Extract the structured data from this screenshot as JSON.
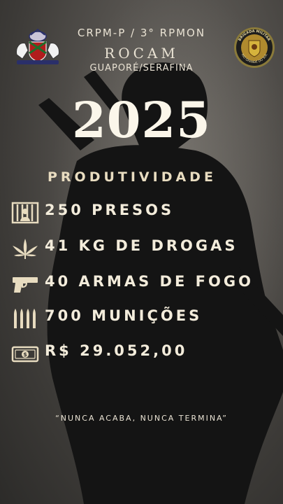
{
  "header": {
    "line1": "CRPM-P / 3° RPMON",
    "line2": "ROCAM",
    "line3": "GUAPORÉ/SERAFINA"
  },
  "right_badge": {
    "top_text": "BRIGADA MILITAR",
    "bottom_text": "RIO GRANDE DO SUL"
  },
  "year": "2025",
  "subtitle": "PRODUTIVIDADE",
  "stats": [
    {
      "icon": "jail-bars-icon",
      "label": "250 PRESOS"
    },
    {
      "icon": "cannabis-leaf-icon",
      "label": "41 KG DE DROGAS"
    },
    {
      "icon": "pistol-icon",
      "label": "40 ARMAS DE FOGO"
    },
    {
      "icon": "ammunition-icon",
      "label": "700 MUNIÇÕES"
    },
    {
      "icon": "money-bill-icon",
      "label": "R$ 29.052,00"
    }
  ],
  "motto": "“NUNCA ACABA, NUNCA TERMINA”",
  "colors": {
    "accent_text": "#e8dcc0",
    "main_text": "#f3ecdb",
    "background": "#55524e",
    "silhouette": "#141414"
  }
}
